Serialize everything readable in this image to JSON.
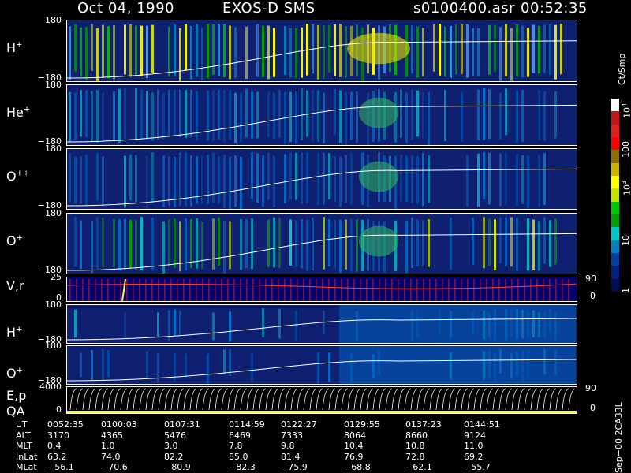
{
  "header": {
    "date": "Oct 04, 1990",
    "instrument": "EXOS-D SMS",
    "file": "s0100400.asr",
    "time": "00:52:35"
  },
  "panels": [
    {
      "label": "H",
      "charge": "+",
      "ymax": "180",
      "ymin": "−180",
      "palette": "bright"
    },
    {
      "label": "He",
      "charge": "+",
      "ymax": "180",
      "ymin": "−180",
      "palette": "dim"
    },
    {
      "label": "O",
      "charge": "++",
      "ymax": "180",
      "ymin": "−180",
      "palette": "dim"
    },
    {
      "label": "O",
      "charge": "+",
      "ymax": "180",
      "ymin": "−180",
      "palette": "mid"
    },
    {
      "label": "V,r",
      "charge": "",
      "ymax": "25",
      "ymin": "0",
      "palette": "vr",
      "rmax": "90",
      "rmin": "0"
    },
    {
      "label": "H",
      "charge": "+",
      "ymax": "180",
      "ymin": "−180",
      "palette": "low"
    },
    {
      "label": "O",
      "charge": "+",
      "ymax": "180",
      "ymin": "−180",
      "palette": "low"
    },
    {
      "label": "E,p",
      "label2": "QA",
      "charge": "",
      "ymax": "4000",
      "ymin": "0",
      "palette": "ep",
      "rmax": "90",
      "rmin": "0"
    }
  ],
  "colorbar": {
    "unit": "Ct/Smp",
    "ticks": [
      "10",
      "100",
      "10",
      "10",
      "1"
    ],
    "tick_sups": [
      "4",
      "",
      "3",
      "",
      ""
    ],
    "colors": [
      "#ffffff",
      "#c01818",
      "#e02020",
      "#ff0000",
      "#8c7000",
      "#c8b400",
      "#ffff00",
      "#c8e000",
      "#00c800",
      "#00a000",
      "#00c8c8",
      "#0080c0",
      "#0040a0",
      "#002080",
      "#001050"
    ]
  },
  "footer": {
    "rows": [
      {
        "name": "UT",
        "values": [
          "0052:35",
          "0100:03",
          "0107:31",
          "0114:59",
          "0122:27",
          "0129:55",
          "0137:23",
          "0144:51"
        ]
      },
      {
        "name": "ALT",
        "values": [
          "3170",
          "4365",
          "5476",
          "6469",
          "7333",
          "8064",
          "8660",
          "9124"
        ]
      },
      {
        "name": "MLT",
        "values": [
          "0.4",
          "1.0",
          "3.0",
          "7.8",
          "9.8",
          "10.4",
          "10.8",
          "11.0"
        ]
      },
      {
        "name": "InLat",
        "values": [
          "63.2",
          "74.0",
          "82.2",
          "85.0",
          "81.4",
          "76.9",
          "72.8",
          "69.2"
        ]
      },
      {
        "name": "MLat",
        "values": [
          "−56.1",
          "−70.6",
          "−80.9",
          "−82.3",
          "−75.9",
          "−68.8",
          "−62.1",
          "−55.7"
        ]
      }
    ],
    "version": "Sep−00 2CA33L"
  },
  "chart_data": {
    "type": "heatmap",
    "title": "Oct 04, 1990   EXOS-D SMS",
    "x_ticks": [
      "0052:35",
      "0100:03",
      "0107:31",
      "0114:59",
      "0122:27",
      "0129:55",
      "0137:23",
      "0144:51"
    ],
    "series": [
      {
        "name": "H+",
        "ylim": [
          -180,
          180
        ]
      },
      {
        "name": "He+",
        "ylim": [
          -180,
          180
        ]
      },
      {
        "name": "O++",
        "ylim": [
          -180,
          180
        ]
      },
      {
        "name": "O+",
        "ylim": [
          -180,
          180
        ]
      },
      {
        "name": "V,r",
        "ylim": [
          0,
          25
        ]
      },
      {
        "name": "H+",
        "ylim": [
          -180,
          180
        ]
      },
      {
        "name": "O+",
        "ylim": [
          -180,
          180
        ]
      },
      {
        "name": "E,p",
        "ylim": [
          0,
          4000
        ]
      }
    ],
    "colorbar_range": [
      1,
      10000
    ],
    "colorbar_unit": "Ct/Smp",
    "colorbar_scale": "log"
  }
}
